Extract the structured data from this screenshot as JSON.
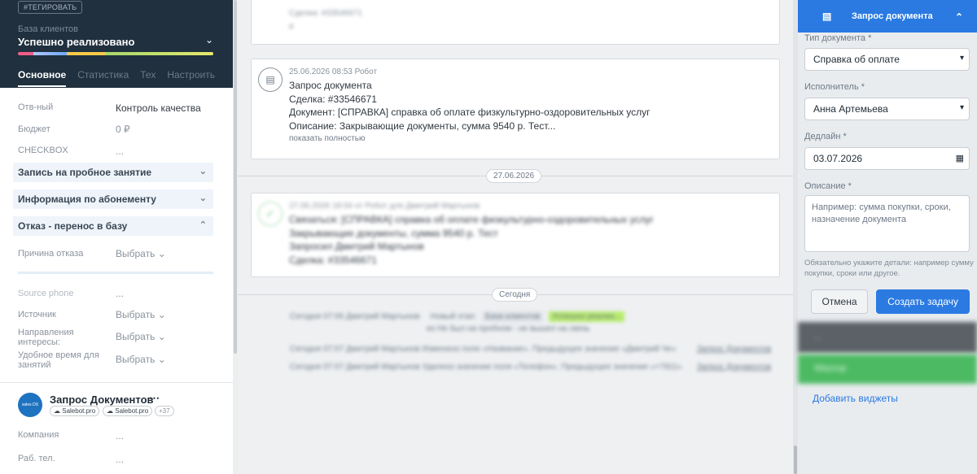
{
  "left": {
    "tag_button": "#ТЕГИРОВАТЬ",
    "pipeline_label": "База клиентов",
    "pipeline_value": "Успешно реализовано",
    "tabs": [
      "Основное",
      "Статистика",
      "Тех",
      "Настроить"
    ],
    "fields": {
      "responsible_label": "Отв-ный",
      "responsible_value": "Контроль качества",
      "budget_label": "Бюджет",
      "budget_value": "0 ₽",
      "checkbox_label": "CHECKBOX",
      "checkbox_value": "..."
    },
    "sections": [
      "Запись на пробное занятие",
      "Информация по абонементу",
      "Отказ - перенос в базу"
    ],
    "refusal_label": "Причина отказа",
    "refusal_value": "Выбрать",
    "source_phone_label": "Source phone",
    "source_phone_value": "...",
    "source_label": "Источник",
    "source_value": "Выбрать",
    "interests_label_1": "Направления",
    "interests_label_2": "интересы:",
    "interests_value": "Выбрать",
    "time_label_1": "Удобное время для",
    "time_label_2": "занятий",
    "time_value": "Выбрать",
    "contact": {
      "avatar_text": "sales.OS",
      "name": "Запрос Документов",
      "chips": [
        "Salebot.pro",
        "Salebot.pro",
        "+37"
      ],
      "company_label": "Компания",
      "company_value": "...",
      "phone_label": "Раб. тел.",
      "phone_value": "..."
    }
  },
  "feed": {
    "top_card_lines": [
      "Сделка: #33546671",
      "#"
    ],
    "card": {
      "meta": "25.06.2026 08:53 Робот",
      "title": "Запрос документа",
      "deal": "Сделка: #33546671",
      "document": "Документ: [СПРАВКА] справка об оплате физкультурно-оздоровительных услуг",
      "description": "Описание: Закрывающие документы, сумма 9540 р. Тест...",
      "show_more": "показать полностью"
    },
    "date_1": "27.06.2026",
    "done_card": {
      "meta": "27.06.2026 18:04  от Робот для Дмитрий Мартынов",
      "lines": [
        "Связаться: [СПРАВКА] справка об оплате физкультурно-оздоровительных услуг",
        "Закрывающие документы, сумма 9540 р. Тест",
        "Запросил Дмитрий Мартынов",
        "Сделка: #33546671"
      ]
    },
    "date_2": "Сегодня",
    "events": [
      {
        "text": "Сегодня 07:06 Дмитрий Мартынов",
        "extra": "Новый этап:",
        "stage_from": "База клиентов",
        "stage_to": "Успешно реализ...",
        "sub": "из Не был на пробном - не вышел на связь"
      },
      {
        "text": "Сегодня 07:07 Дмитрий Мартынов Изменено поле «Название». Предыдущее значение «Дмитрий Че»",
        "link": "Запрос Документов"
      },
      {
        "text": "Сегодня 07:07 Дмитрий Мартынов Удалено значение поля «Телефон». Предыдущее значение «+7911»",
        "link": "Запрос Документов"
      }
    ]
  },
  "panel": {
    "title": "Запрос документа",
    "type_label": "Тип документа *",
    "type_value": "Справка об оплате",
    "executor_label": "Исполнитель *",
    "executor_value": "Анна Артемьева",
    "deadline_label": "Дедлайн *",
    "deadline_value": "03.07.2026",
    "description_label": "Описание *",
    "description_placeholder": "Например: сумма покупки, сроки, назначение документа",
    "hint": "Обязательно укажите детали: например сумму покупки, сроки или другое.",
    "cancel_label": "Отмена",
    "create_label": "Создать задачу",
    "widget_1": "...",
    "widget_2": "Wazzup",
    "add_widgets": "Добавить виджеты"
  },
  "colors": {
    "accent": "#2a7ae2",
    "header_dark": "#20303e",
    "success_green": "#7dc98a"
  }
}
